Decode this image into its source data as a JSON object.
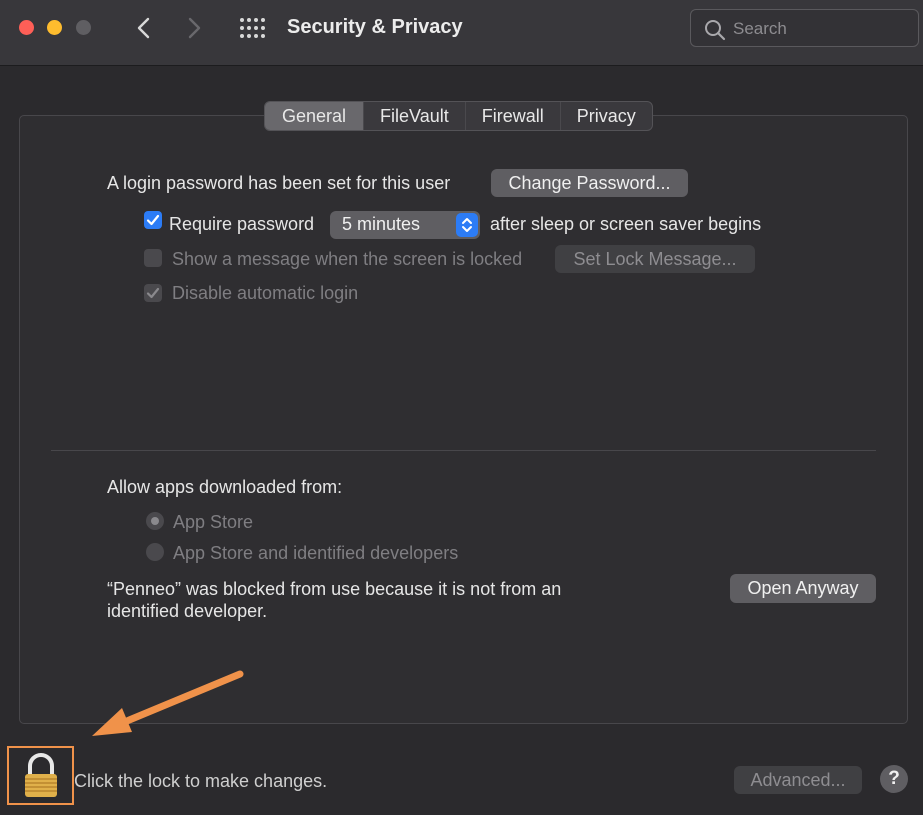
{
  "window": {
    "title": "Security & Privacy",
    "search_placeholder": "Search"
  },
  "tabs": [
    {
      "label": "General",
      "active": true
    },
    {
      "label": "FileVault",
      "active": false
    },
    {
      "label": "Firewall",
      "active": false
    },
    {
      "label": "Privacy",
      "active": false
    }
  ],
  "general": {
    "login_password_text": "A login password has been set for this user",
    "change_password_label": "Change Password...",
    "require_password_label": "Require password",
    "require_password_checked": true,
    "require_password_delay": "5 minutes",
    "after_sleep_text": "after sleep or screen saver begins",
    "show_message_label": "Show a message when the screen is locked",
    "show_message_checked": false,
    "set_lock_message_label": "Set Lock Message...",
    "disable_auto_login_label": "Disable automatic login",
    "disable_auto_login_checked": true
  },
  "downloads": {
    "heading": "Allow apps downloaded from:",
    "option_app_store": "App Store",
    "option_identified": "App Store and identified developers",
    "selected": "App Store",
    "blocked_line1": "“Penneo” was blocked from use because it is not from an",
    "blocked_line2": "identified developer.",
    "open_anyway_label": "Open Anyway"
  },
  "footer": {
    "lock_text": "Click the lock to make changes.",
    "advanced_label": "Advanced...",
    "help_label": "?"
  },
  "colors": {
    "accent": "#2c7cf6",
    "annotation": "#f0924a"
  }
}
